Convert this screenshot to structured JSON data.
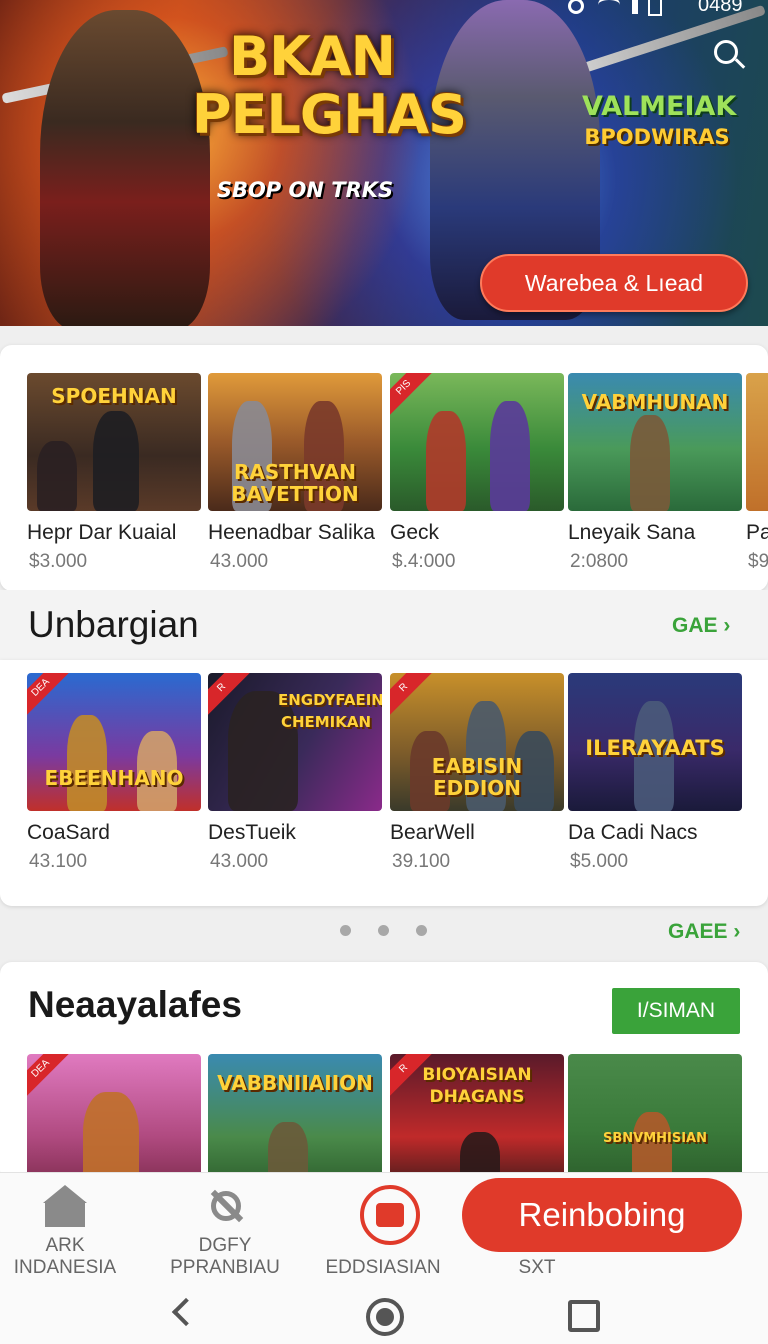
{
  "status_bar": {
    "time": "0489"
  },
  "hero": {
    "title_line1": "BKAN",
    "title_line2": "PELGHAS",
    "subtitle": "SBOP ON TRKS",
    "logo2_line1": "VALMEIAK",
    "logo2_line2": "BPODWIRAS",
    "cta_label": "Warebea & Lıead"
  },
  "row1": {
    "items": [
      {
        "name": "Hepr Dar Kuaial",
        "price": "$3.000",
        "art": "SPOEHNAN",
        "ribbon": ""
      },
      {
        "name": "Heenadbar Salika",
        "price": "43.000",
        "art": "RASTHVAN BAVETTION",
        "ribbon": ""
      },
      {
        "name": "Geck",
        "price": "$.4:000",
        "art": "",
        "ribbon": "PIS"
      },
      {
        "name": "Lneyaik Sana",
        "price": "2:0800",
        "art": "VABMHUNAN",
        "ribbon": ""
      },
      {
        "name": "Pa",
        "price": "$9",
        "art": "",
        "ribbon": ""
      }
    ]
  },
  "section2": {
    "title": "Unbargian",
    "see_all": "GAE ›",
    "items": [
      {
        "name": "CoaSard",
        "price": "43.100",
        "art": "EBEENHANO",
        "ribbon": "DEA"
      },
      {
        "name": "DesTueik",
        "price": "43.000",
        "art": "ENGDYFAEIN CHEMIKAN",
        "ribbon": "R"
      },
      {
        "name": "BearWell",
        "price": "39.100",
        "art": "EABISIN EDDION",
        "ribbon": "R"
      },
      {
        "name": "Da Cadi Nacs",
        "price": "$5.000",
        "art": "ILERAYAATS",
        "ribbon": ""
      }
    ]
  },
  "pager": {
    "see_all": "GAEE ›"
  },
  "section3": {
    "title": "Neaayalafes",
    "button": "I/SIMAN",
    "items": [
      {
        "art": "",
        "ribbon": "DEA"
      },
      {
        "art": "VABBNIIAIION",
        "ribbon": ""
      },
      {
        "art": "BIOYAISIAN DHAGANS",
        "ribbon": "R"
      },
      {
        "art": "SBNVMHISIAN",
        "ribbon": ""
      }
    ]
  },
  "bottom_nav": {
    "item1_line1": "ARK",
    "item1_line2": "INDANESIA",
    "item2_line1": "DGFY",
    "item2_line2": "PPRANBIAU",
    "item3_line2": "EDDSIASIAN",
    "item4_line2": "SXT",
    "cta_label": "Reinbobing"
  },
  "colors": {
    "accent_red": "#e03a2a",
    "accent_green": "#3aa33a"
  }
}
